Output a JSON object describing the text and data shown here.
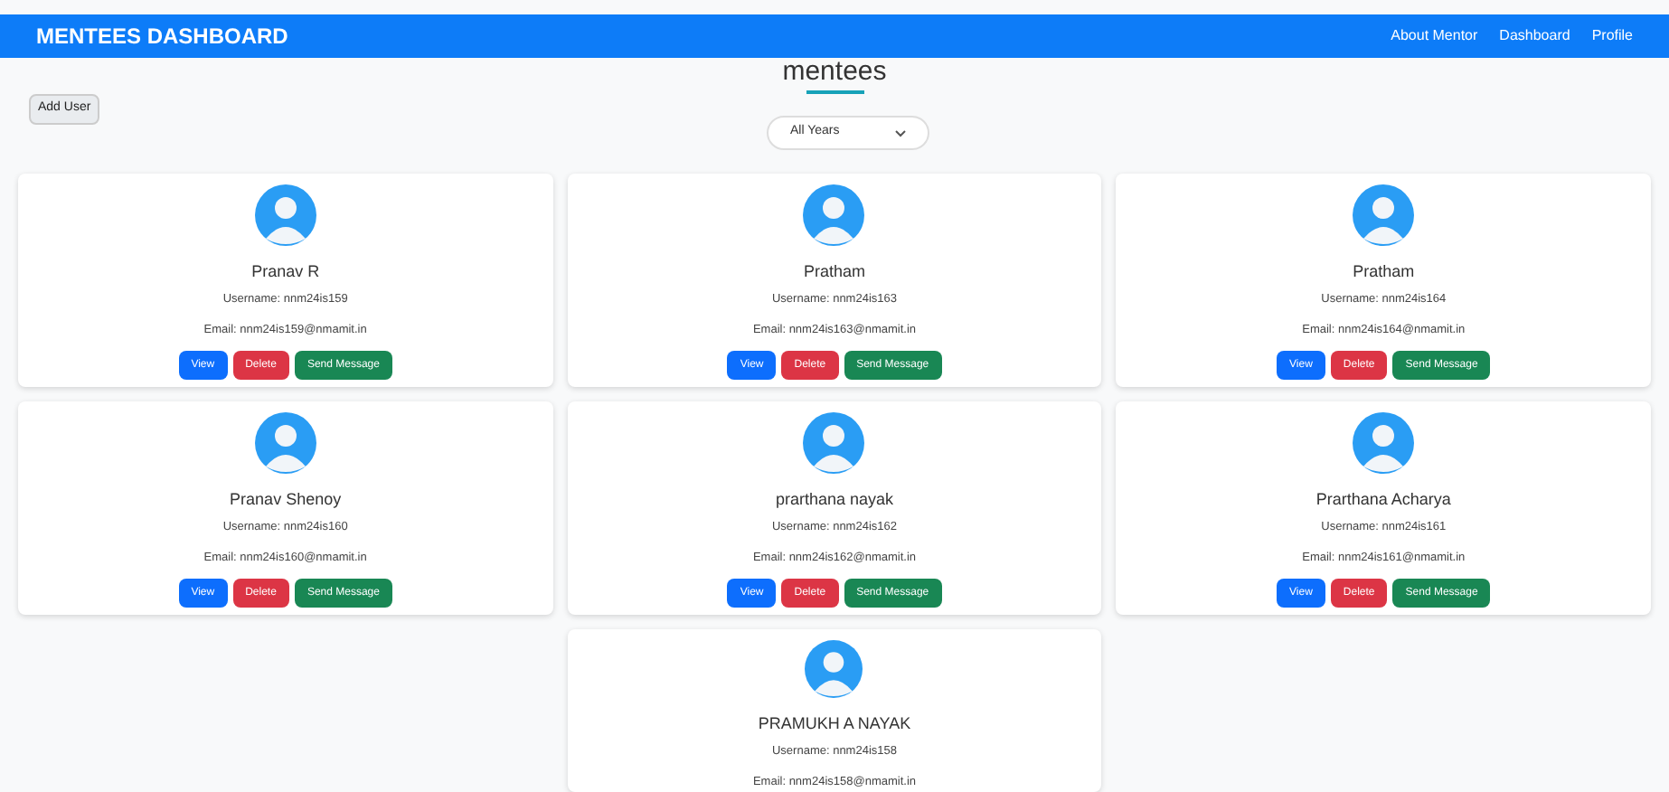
{
  "navbar": {
    "brand": "MENTEES DASHBOARD",
    "links": [
      "About Mentor",
      "Dashboard",
      "Profile"
    ]
  },
  "heading": "mentees",
  "add_user_button": "Add User",
  "year_filter": {
    "value": "All Years"
  },
  "mentees": [
    {
      "name": "Pranav R",
      "username": "Username: nnm24is159",
      "email": "Email: nnm24is159@nmamit.in",
      "buttons": [
        "View",
        "Delete",
        "Send Message"
      ]
    },
    {
      "name": "Pratham",
      "username": "Username: nnm24is163",
      "email": "Email: nnm24is163@nmamit.in",
      "buttons": [
        "View",
        "Delete",
        "Send Message"
      ]
    },
    {
      "name": "Pratham",
      "username": "Username: nnm24is164",
      "email": "Email: nnm24is164@nmamit.in",
      "buttons": [
        "View",
        "Delete",
        "Send Message"
      ]
    },
    {
      "name": "Pranav Shenoy",
      "username": "Username: nnm24is160",
      "email": "Email: nnm24is160@nmamit.in",
      "buttons": [
        "View",
        "Delete",
        "Send Message"
      ]
    },
    {
      "name": "prarthana nayak",
      "username": "Username: nnm24is162",
      "email": "Email: nnm24is162@nmamit.in",
      "buttons": [
        "View",
        "Delete",
        "Send Message"
      ]
    },
    {
      "name": "Prarthana Acharya",
      "username": "Username: nnm24is161",
      "email": "Email: nnm24is161@nmamit.in",
      "buttons": [
        "View",
        "Delete",
        "Send Message"
      ]
    },
    {
      "name": "PRAMUKH A NAYAK",
      "username": "Username: nnm24is158",
      "email": "Email: nnm24is158@nmamit.in"
    }
  ]
}
